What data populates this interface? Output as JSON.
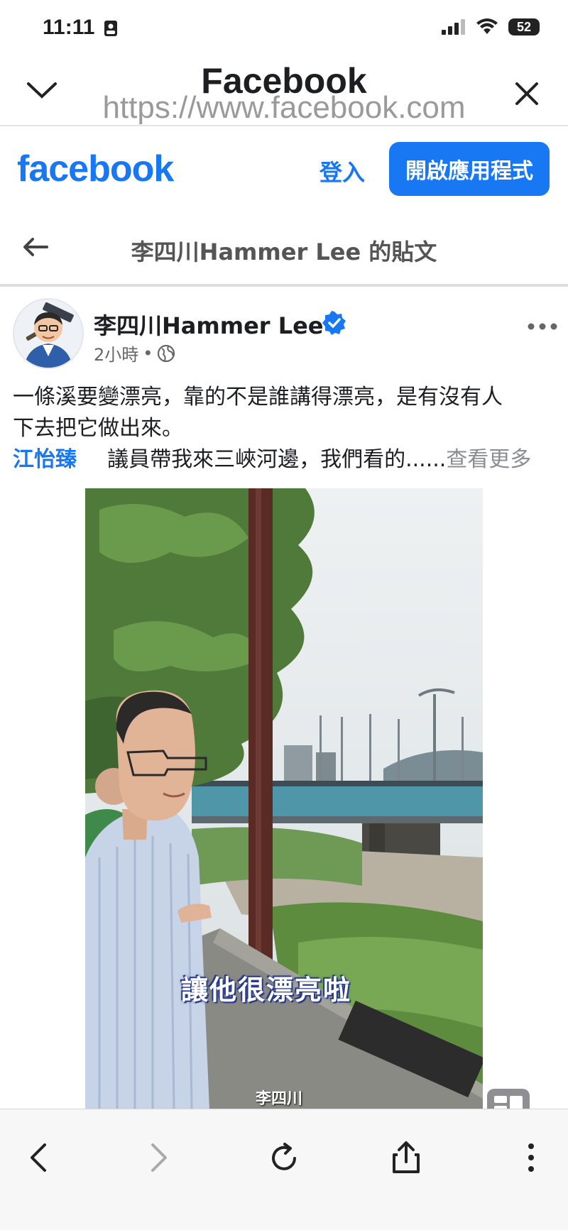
{
  "status_bar": {
    "time": "11:11",
    "battery": "52"
  },
  "browser": {
    "title": "Facebook",
    "url": "https://www.facebook.com"
  },
  "facebook": {
    "logo": "facebook",
    "login": "登入",
    "open_app": "開啟應用程式"
  },
  "page": {
    "title": "李四川Hammer Lee 的貼文"
  },
  "post": {
    "author": "李四川Hammer Lee",
    "time": "2小時",
    "dot": "•",
    "line1": "一條溪要變漂亮，靠的不是誰講得漂亮，是有沒有人",
    "line2": "下去把它做出來。",
    "tag": "江怡臻",
    "line3": "議員帶我來三峽河邊，我們看的......",
    "see_more": "查看更多"
  },
  "video": {
    "caption": "讓他很漂亮啦",
    "watermark": "李四川"
  },
  "colors": {
    "accent": "#1877f2",
    "text": "#1c1e21",
    "muted": "#65676b"
  },
  "icons": [
    "chevron-down-icon",
    "close-icon",
    "back-arrow-icon",
    "verified-icon",
    "globe-icon",
    "more-icon",
    "chat-icon",
    "back-icon",
    "forward-icon",
    "reload-icon",
    "share-icon",
    "vertical-dots-icon"
  ]
}
